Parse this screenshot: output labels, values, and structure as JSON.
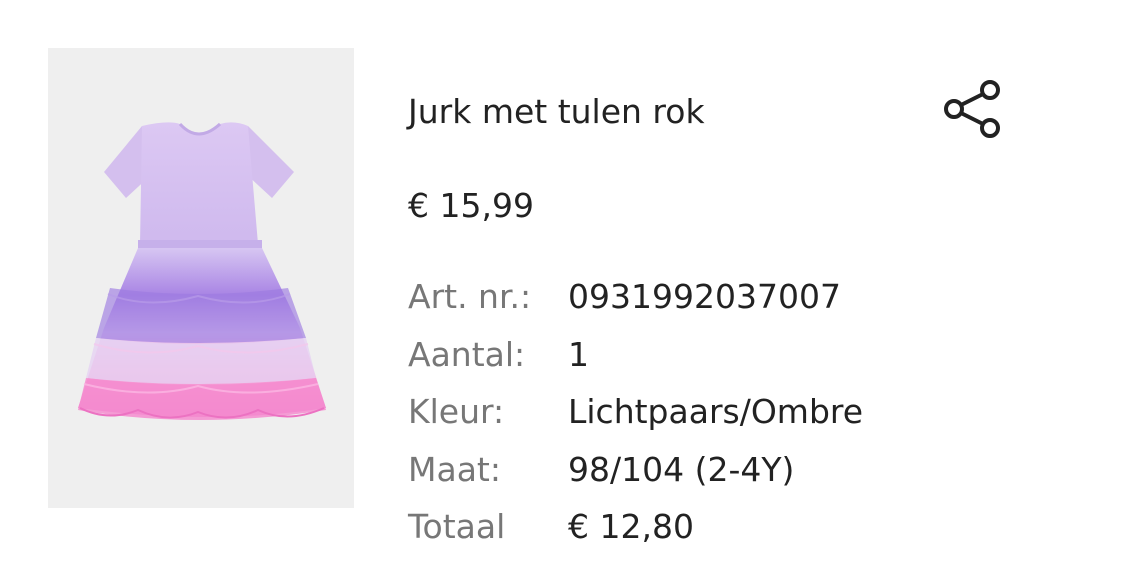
{
  "product": {
    "title": "Jurk met tulen rok",
    "price": "€ 15,99",
    "image_alt": "dress-with-tulle-skirt",
    "colors": {
      "bodice": "#d9c4f0",
      "tulle_top": "#c7b3ec",
      "tulle_mid": "#9d7ae0",
      "tulle_light": "#ddc8f0",
      "tulle_pink": "#f48fd0",
      "image_bg": "#efefef"
    }
  },
  "details": [
    {
      "label": "Art. nr.:",
      "value": "0931992037007"
    },
    {
      "label": "Aantal:",
      "value": "1"
    },
    {
      "label": "Kleur:",
      "value": "Lichtpaars/Ombre"
    },
    {
      "label": "Maat:",
      "value": "98/104 (2-4Y)"
    },
    {
      "label": "Totaal",
      "value": "€ 12,80"
    }
  ],
  "actions": {
    "share_icon": "share-icon"
  }
}
